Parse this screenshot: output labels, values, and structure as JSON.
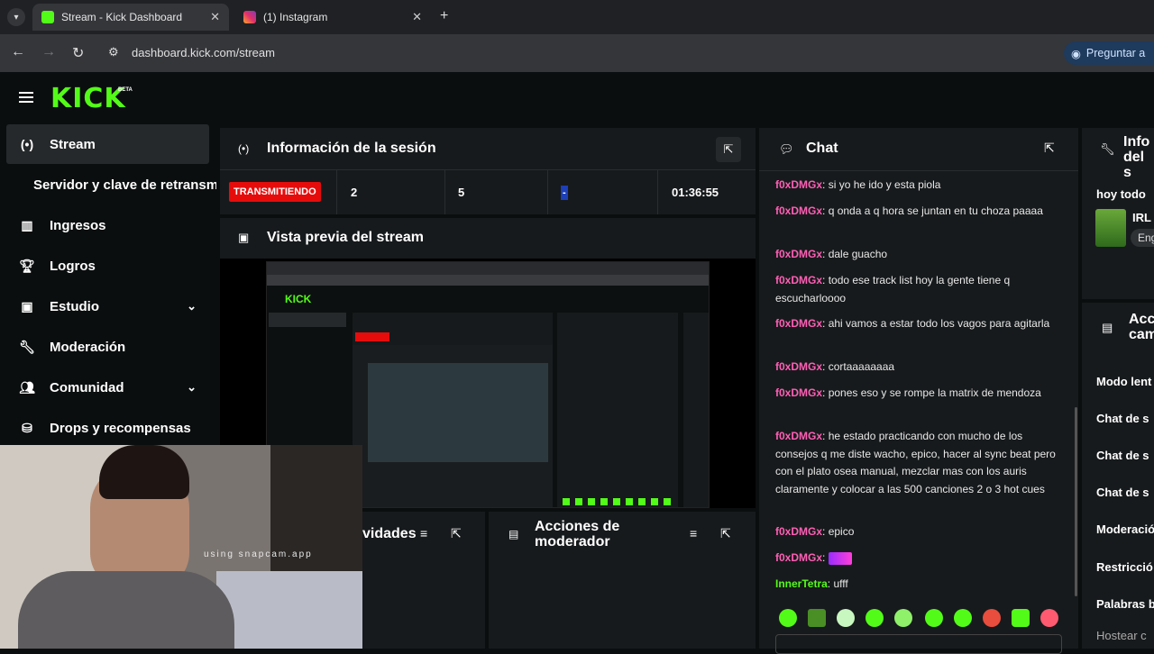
{
  "browser": {
    "tabs": [
      {
        "label": "Stream - Kick Dashboard",
        "active": true
      },
      {
        "label": "(1) Instagram",
        "active": false
      }
    ],
    "url": "dashboard.kick.com/stream",
    "ask_button": "Preguntar a"
  },
  "brand": {
    "logo": "KICK",
    "beta": "BETA",
    "accent": "#53fc18"
  },
  "sidebar": {
    "items": [
      {
        "label": "Stream",
        "icon": "broadcast-icon"
      },
      {
        "label": "Servidor y clave de retransm",
        "icon": ""
      },
      {
        "label": "Ingresos",
        "icon": "chart-icon"
      },
      {
        "label": "Logros",
        "icon": "trophy-icon"
      },
      {
        "label": "Estudio",
        "icon": "studio-icon"
      },
      {
        "label": "Moderación",
        "icon": "wrench-icon"
      },
      {
        "label": "Comunidad",
        "icon": "community-icon"
      },
      {
        "label": "Drops y recompensas",
        "icon": "drops-icon"
      }
    ]
  },
  "session": {
    "title": "Información de la sesión",
    "status": "TRANSMITIENDO",
    "stat1": "2",
    "stat2": "5",
    "stat3": "-",
    "duration": "01:36:55"
  },
  "preview": {
    "title": "Vista previa del stream"
  },
  "activity": {
    "title": "vidades"
  },
  "mod_actions": {
    "title": "Acciones de moderador"
  },
  "chat": {
    "title": "Chat",
    "messages": [
      {
        "user": "f0xDMGx",
        "text": "si yo he ido y esta piola"
      },
      {
        "user": "f0xDMGx",
        "text": "q onda a q hora se juntan en tu choza paaaa"
      },
      {
        "user": "f0xDMGx",
        "text": "dale guacho"
      },
      {
        "user": "f0xDMGx",
        "text": "todo ese track list hoy la gente tiene q escucharloooo"
      },
      {
        "user": "f0xDMGx",
        "text": "ahi vamos a estar todo los vagos para agitarla"
      },
      {
        "user": "f0xDMGx",
        "text": "cortaaaaaaaa"
      },
      {
        "user": "f0xDMGx",
        "text": "pones eso y se rompe la matrix de mendoza"
      },
      {
        "user": "f0xDMGx",
        "text": "he estado practicando con mucho de los consejos q me diste wacho, epico, hacer al sync beat pero con el plato osea manual, mezclar mas con los auris claramente y colocar a las 500 canciones 2 o 3 hot cues"
      },
      {
        "user": "f0xDMGx",
        "text": "epico"
      },
      {
        "user": "f0xDMGx",
        "text": ""
      },
      {
        "user": "InnerTetra",
        "text": "ufff"
      }
    ]
  },
  "right_panel": {
    "info_title": "Info del s",
    "today": "hoy todo",
    "category": "IRL",
    "tag": "Eng",
    "actions_title": "Acc cam",
    "items": [
      "Modo lent",
      "Chat de s",
      "Chat de s",
      "Chat de s",
      "Moderació",
      "Restricció",
      "Palabras b",
      "Hostear c"
    ]
  },
  "webcam": {
    "watermark": "using snapcam.app"
  }
}
